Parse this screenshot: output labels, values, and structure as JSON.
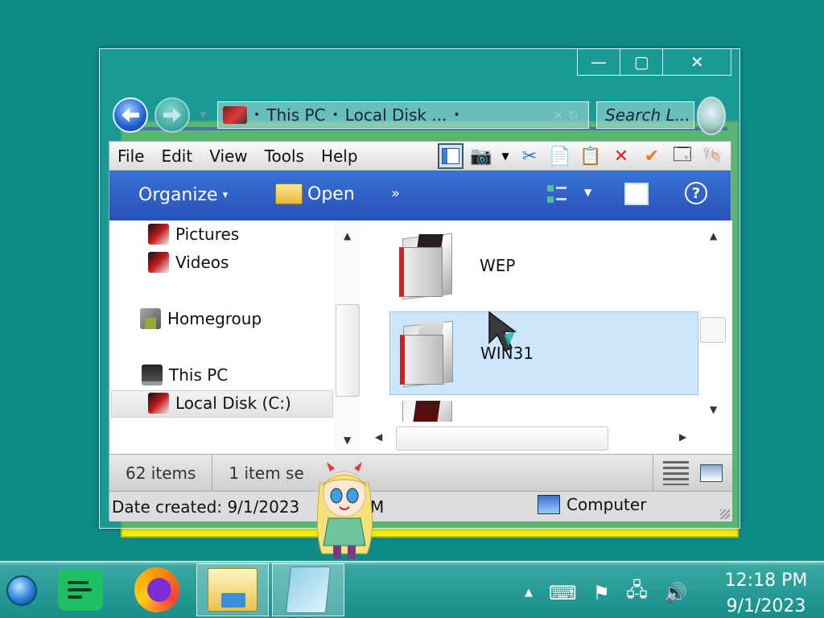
{
  "window": {
    "caption": {
      "minimize": "—",
      "maximize": "▢",
      "close": "✕"
    },
    "address": {
      "crumb_sep": "•",
      "crumb_1": "This PC",
      "crumb_2": "Local Disk ...",
      "tail": "✕ ↻"
    },
    "search": {
      "placeholder": "Search L..."
    },
    "menu": [
      "File",
      "Edit",
      "View",
      "Tools",
      "Help"
    ],
    "commands": {
      "organize": "Organize",
      "organize_arrow": "▾",
      "open": "Open",
      "more": "»",
      "help": "?"
    },
    "nav_pane": {
      "items": [
        {
          "label": "Pictures"
        },
        {
          "label": "Videos"
        },
        {
          "label": "Homegroup"
        },
        {
          "label": "This PC"
        },
        {
          "label": "Local Disk (C:)"
        }
      ]
    },
    "files": [
      {
        "name": "WEP",
        "selected": false
      },
      {
        "name": "WIN31",
        "selected": true
      }
    ],
    "status": {
      "item_count": "62 items",
      "selected": "1 item se",
      "date_created": "Date created: 9/1/2023",
      "date_tail": "AM",
      "location": "Computer"
    }
  },
  "taskbar": {
    "apps": [
      {
        "name": "Notes",
        "active": false
      },
      {
        "name": "Firefox",
        "active": false
      },
      {
        "name": "File Explorer",
        "active": true
      },
      {
        "name": "Notepad",
        "active": true
      }
    ],
    "tray": {
      "expand": "▲"
    },
    "clock": {
      "time": "12:18 PM",
      "date": "9/1/2023"
    }
  },
  "colors": {
    "desktop": "#0f8b86",
    "command_bar": "#2a5cc4",
    "selection": "#cde6fb",
    "yellow_back": "#f0f000"
  }
}
